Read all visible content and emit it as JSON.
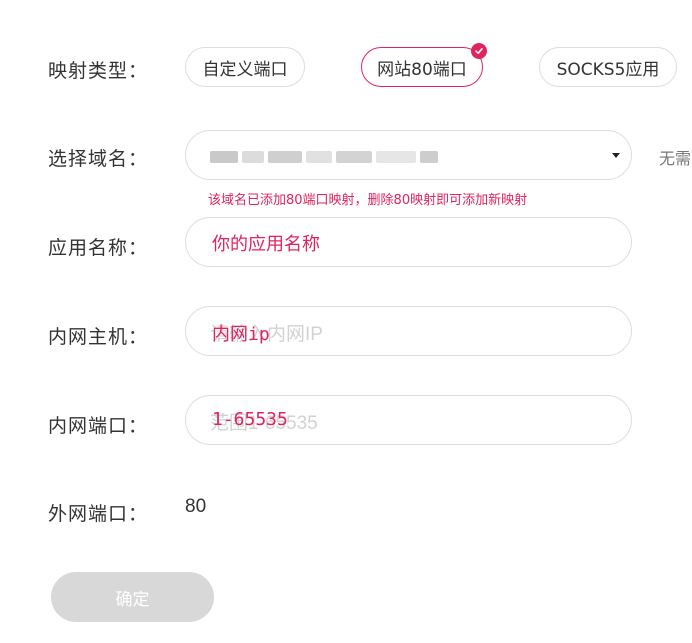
{
  "form": {
    "mapping_type": {
      "label": "映射类型：",
      "options": [
        {
          "label": "自定义端口",
          "selected": false
        },
        {
          "label": "网站80端口",
          "selected": true
        },
        {
          "label": "SOCKS5应用",
          "selected": false
        }
      ]
    },
    "domain": {
      "label": "选择域名：",
      "selected_value": "",
      "side_note": "无需",
      "hint": "该域名已添加80端口映射，删除80映射即可添加新映射"
    },
    "app_name": {
      "label": "应用名称：",
      "placeholder": "",
      "overlay_text": "你的应用名称"
    },
    "internal_host": {
      "label": "内网主机：",
      "placeholder": "请输入内网IP",
      "overlay_text": "内网ip"
    },
    "internal_port": {
      "label": "内网端口：",
      "placeholder": "范围1-65535",
      "overlay_text": "1-65535"
    },
    "external_port": {
      "label": "外网端口：",
      "value": "80"
    },
    "submit_label": "确定"
  },
  "colors": {
    "accent": "#e0245e",
    "border": "#dddddd",
    "disabled_button": "#d8d8d8"
  }
}
